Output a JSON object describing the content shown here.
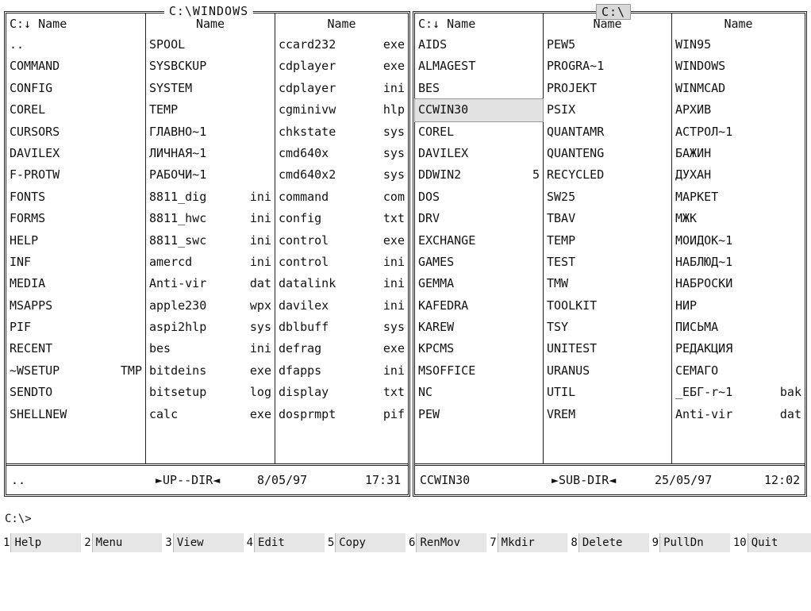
{
  "left_panel": {
    "title": "C:\\WINDOWS",
    "columns": [
      {
        "header": "C:↓ Name",
        "items": [
          {
            "name": "..",
            "ext": ""
          },
          {
            "name": "COMMAND",
            "ext": ""
          },
          {
            "name": "CONFIG",
            "ext": ""
          },
          {
            "name": "COREL",
            "ext": ""
          },
          {
            "name": "CURSORS",
            "ext": ""
          },
          {
            "name": "DAVILEX",
            "ext": ""
          },
          {
            "name": "F-PROTW",
            "ext": ""
          },
          {
            "name": "FONTS",
            "ext": ""
          },
          {
            "name": "FORMS",
            "ext": ""
          },
          {
            "name": "HELP",
            "ext": ""
          },
          {
            "name": "INF",
            "ext": ""
          },
          {
            "name": "MEDIA",
            "ext": ""
          },
          {
            "name": "MSAPPS",
            "ext": ""
          },
          {
            "name": "PIF",
            "ext": ""
          },
          {
            "name": "RECENT",
            "ext": ""
          },
          {
            "name": "~WSETUP",
            "ext": "TMP"
          },
          {
            "name": "SENDTO",
            "ext": ""
          },
          {
            "name": "SHELLNEW",
            "ext": ""
          }
        ]
      },
      {
        "header": "Name",
        "items": [
          {
            "name": "SPOOL",
            "ext": ""
          },
          {
            "name": "SYSBCKUP",
            "ext": ""
          },
          {
            "name": "SYSTEM",
            "ext": ""
          },
          {
            "name": "TEMP",
            "ext": ""
          },
          {
            "name": "ГЛАВНО~1",
            "ext": ""
          },
          {
            "name": "ЛИЧНАЯ~1",
            "ext": ""
          },
          {
            "name": "РАБОЧИ~1",
            "ext": ""
          },
          {
            "name": "8811_dig",
            "ext": "ini"
          },
          {
            "name": "8811_hwc",
            "ext": "ini"
          },
          {
            "name": "8811_swc",
            "ext": "ini"
          },
          {
            "name": "amercd",
            "ext": "ini"
          },
          {
            "name": "Anti-vir",
            "ext": "dat"
          },
          {
            "name": "apple230",
            "ext": "wpx"
          },
          {
            "name": "aspi2hlp",
            "ext": "sys"
          },
          {
            "name": "bes",
            "ext": "ini"
          },
          {
            "name": "bitdeins",
            "ext": "exe"
          },
          {
            "name": "bitsetup",
            "ext": "log"
          },
          {
            "name": "calc",
            "ext": "exe"
          }
        ]
      },
      {
        "header": "Name",
        "items": [
          {
            "name": "ccard232",
            "ext": "exe"
          },
          {
            "name": "cdplayer",
            "ext": "exe"
          },
          {
            "name": "cdplayer",
            "ext": "ini"
          },
          {
            "name": "cgminivw",
            "ext": "hlp"
          },
          {
            "name": "chkstate",
            "ext": "sys"
          },
          {
            "name": "cmd640x",
            "ext": "sys"
          },
          {
            "name": "cmd640x2",
            "ext": "sys"
          },
          {
            "name": "command",
            "ext": "com"
          },
          {
            "name": "config",
            "ext": "txt"
          },
          {
            "name": "control",
            "ext": "exe"
          },
          {
            "name": "control",
            "ext": "ini"
          },
          {
            "name": "datalink",
            "ext": "ini"
          },
          {
            "name": "davilex",
            "ext": "ini"
          },
          {
            "name": "dblbuff",
            "ext": "sys"
          },
          {
            "name": "defrag",
            "ext": "exe"
          },
          {
            "name": "dfapps",
            "ext": "ini"
          },
          {
            "name": "display",
            "ext": "txt"
          },
          {
            "name": "dosprmpt",
            "ext": "pif"
          }
        ]
      }
    ],
    "info": {
      "name": "..",
      "type": "►UP--DIR◄",
      "date": "8/05/97",
      "time": "17:31"
    }
  },
  "right_panel": {
    "title": "C:\\",
    "columns": [
      {
        "header": "C:↓ Name",
        "items": [
          {
            "name": "AIDS",
            "ext": ""
          },
          {
            "name": "ALMAGEST",
            "ext": ""
          },
          {
            "name": "BES",
            "ext": ""
          },
          {
            "name": "CCWIN30",
            "ext": "",
            "selected": true
          },
          {
            "name": "COREL",
            "ext": ""
          },
          {
            "name": "DAVILEX",
            "ext": ""
          },
          {
            "name": "DDWIN2",
            "ext": "5"
          },
          {
            "name": "DOS",
            "ext": ""
          },
          {
            "name": "DRV",
            "ext": ""
          },
          {
            "name": "EXCHANGE",
            "ext": ""
          },
          {
            "name": "GAMES",
            "ext": ""
          },
          {
            "name": "GEMMA",
            "ext": ""
          },
          {
            "name": "KAFEDRA",
            "ext": ""
          },
          {
            "name": "KAREW",
            "ext": ""
          },
          {
            "name": "KPCMS",
            "ext": ""
          },
          {
            "name": "MSOFFICE",
            "ext": ""
          },
          {
            "name": "NC",
            "ext": ""
          },
          {
            "name": "PEW",
            "ext": ""
          }
        ]
      },
      {
        "header": "Name",
        "items": [
          {
            "name": "PEW5",
            "ext": ""
          },
          {
            "name": "PROGRA~1",
            "ext": ""
          },
          {
            "name": "PROJEKT",
            "ext": ""
          },
          {
            "name": "PSIX",
            "ext": ""
          },
          {
            "name": "QUANTAMR",
            "ext": ""
          },
          {
            "name": "QUANTENG",
            "ext": ""
          },
          {
            "name": "RECYCLED",
            "ext": ""
          },
          {
            "name": "SW25",
            "ext": ""
          },
          {
            "name": "TBAV",
            "ext": ""
          },
          {
            "name": "TEMP",
            "ext": ""
          },
          {
            "name": "TEST",
            "ext": ""
          },
          {
            "name": "TMW",
            "ext": ""
          },
          {
            "name": "TOOLKIT",
            "ext": ""
          },
          {
            "name": "TSY",
            "ext": ""
          },
          {
            "name": "UNITEST",
            "ext": ""
          },
          {
            "name": "URANUS",
            "ext": ""
          },
          {
            "name": "UTIL",
            "ext": ""
          },
          {
            "name": "VREM",
            "ext": ""
          }
        ]
      },
      {
        "header": "Name",
        "items": [
          {
            "name": "WIN95",
            "ext": ""
          },
          {
            "name": "WINDOWS",
            "ext": ""
          },
          {
            "name": "WINMCAD",
            "ext": ""
          },
          {
            "name": "АРХИВ",
            "ext": ""
          },
          {
            "name": "АСТРОЛ~1",
            "ext": ""
          },
          {
            "name": "БАЖИН",
            "ext": ""
          },
          {
            "name": "ДУХАН",
            "ext": ""
          },
          {
            "name": "МАРКЕТ",
            "ext": ""
          },
          {
            "name": "МЖК",
            "ext": ""
          },
          {
            "name": "МОИДОК~1",
            "ext": ""
          },
          {
            "name": "НАБЛЮД~1",
            "ext": ""
          },
          {
            "name": "НАБРОСКИ",
            "ext": ""
          },
          {
            "name": "НИР",
            "ext": ""
          },
          {
            "name": "ПИСЬМА",
            "ext": ""
          },
          {
            "name": "РЕДАКЦИЯ",
            "ext": ""
          },
          {
            "name": "СЕМАГО",
            "ext": ""
          },
          {
            "name": "_ЕБГ-r~1",
            "ext": "bak"
          },
          {
            "name": "Anti-vir",
            "ext": "dat"
          }
        ]
      }
    ],
    "info": {
      "name": "CCWIN30",
      "type": "►SUB-DIR◄",
      "date": "25/05/97",
      "time": "12:02"
    }
  },
  "prompt": "C:\\>",
  "fkeys": [
    {
      "num": "1",
      "label": "Help"
    },
    {
      "num": "2",
      "label": "Menu"
    },
    {
      "num": "3",
      "label": "View"
    },
    {
      "num": "4",
      "label": "Edit"
    },
    {
      "num": "5",
      "label": "Copy"
    },
    {
      "num": "6",
      "label": "RenMov"
    },
    {
      "num": "7",
      "label": "Mkdir"
    },
    {
      "num": "8",
      "label": "Delete"
    },
    {
      "num": "9",
      "label": "PullDn"
    },
    {
      "num": "10",
      "label": "Quit"
    }
  ]
}
